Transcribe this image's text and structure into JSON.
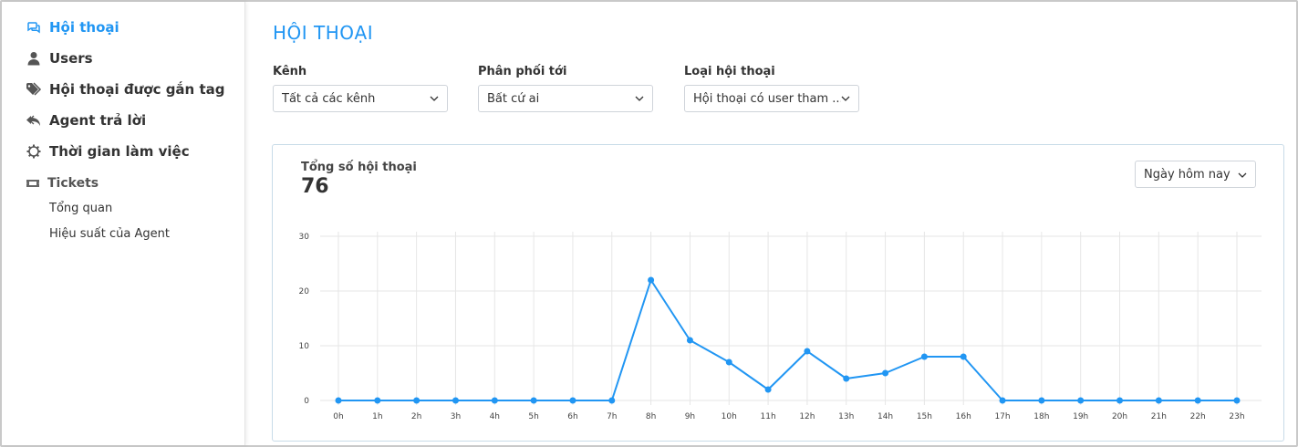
{
  "sidebar": {
    "items": [
      {
        "label": "Hội thoại",
        "icon": "chat-icon",
        "active": true
      },
      {
        "label": "Users",
        "icon": "user-icon",
        "active": false
      },
      {
        "label": "Hội thoại được gắn tag",
        "icon": "tags-icon",
        "active": false
      },
      {
        "label": "Agent trả lời",
        "icon": "reply-all-icon",
        "active": false
      },
      {
        "label": "Thời gian làm việc",
        "icon": "gear-icon",
        "active": false
      }
    ],
    "tickets": {
      "label": "Tickets",
      "icon": "ticket-icon",
      "items": [
        {
          "label": "Tổng quan"
        },
        {
          "label": "Hiệu suất của Agent"
        }
      ]
    }
  },
  "main": {
    "title": "HỘI THOẠI",
    "filters": [
      {
        "label": "Kênh",
        "value": "Tất cả các kênh"
      },
      {
        "label": "Phân phối tới",
        "value": "Bất cứ ai"
      },
      {
        "label": "Loại hội thoại",
        "value": "Hội thoại có user tham ..."
      }
    ],
    "card": {
      "title": "Tổng số hội thoại",
      "total": "76",
      "range": "Ngày hôm nay"
    }
  },
  "colors": {
    "accent": "#2196f3",
    "line": "#2196f3",
    "grid": "#e6e6e6"
  },
  "chart_data": {
    "type": "line",
    "title": "",
    "xlabel": "",
    "ylabel": "",
    "ylim": [
      0,
      30
    ],
    "yticks": [
      0,
      10,
      20,
      30
    ],
    "categories": [
      "0h",
      "1h",
      "2h",
      "3h",
      "4h",
      "5h",
      "6h",
      "7h",
      "8h",
      "9h",
      "10h",
      "11h",
      "12h",
      "13h",
      "14h",
      "15h",
      "16h",
      "17h",
      "18h",
      "19h",
      "20h",
      "21h",
      "22h",
      "23h"
    ],
    "series": [
      {
        "values": [
          0,
          0,
          0,
          0,
          0,
          0,
          0,
          0,
          22,
          11,
          7,
          2,
          9,
          4,
          5,
          8,
          8,
          0,
          0,
          0,
          0,
          0,
          0,
          0
        ]
      }
    ],
    "grid": true,
    "legend": "none"
  }
}
